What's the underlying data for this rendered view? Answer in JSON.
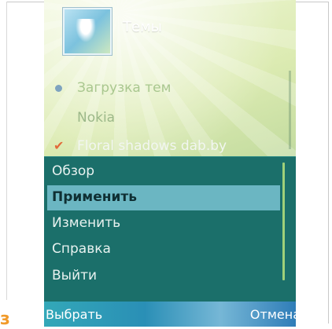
{
  "header": {
    "title": "Темы"
  },
  "list": {
    "items": [
      {
        "label": "Загрузка тем"
      },
      {
        "label": "Nokia"
      },
      {
        "label": "Floral shadows dab.by"
      }
    ]
  },
  "options_menu": {
    "items": [
      {
        "label": "Обзор"
      },
      {
        "label": "Применить"
      },
      {
        "label": "Изменить"
      },
      {
        "label": "Справка"
      },
      {
        "label": "Выйти"
      }
    ],
    "highlighted_index": 1
  },
  "softkeys": {
    "left": "Выбрать",
    "right": "Отмена"
  },
  "corner_mark": "з",
  "colors": {
    "menu_bg": "#1b6f6a",
    "menu_highlight": "#6bb6c2",
    "softkey_bar": "#2a8fb6"
  }
}
